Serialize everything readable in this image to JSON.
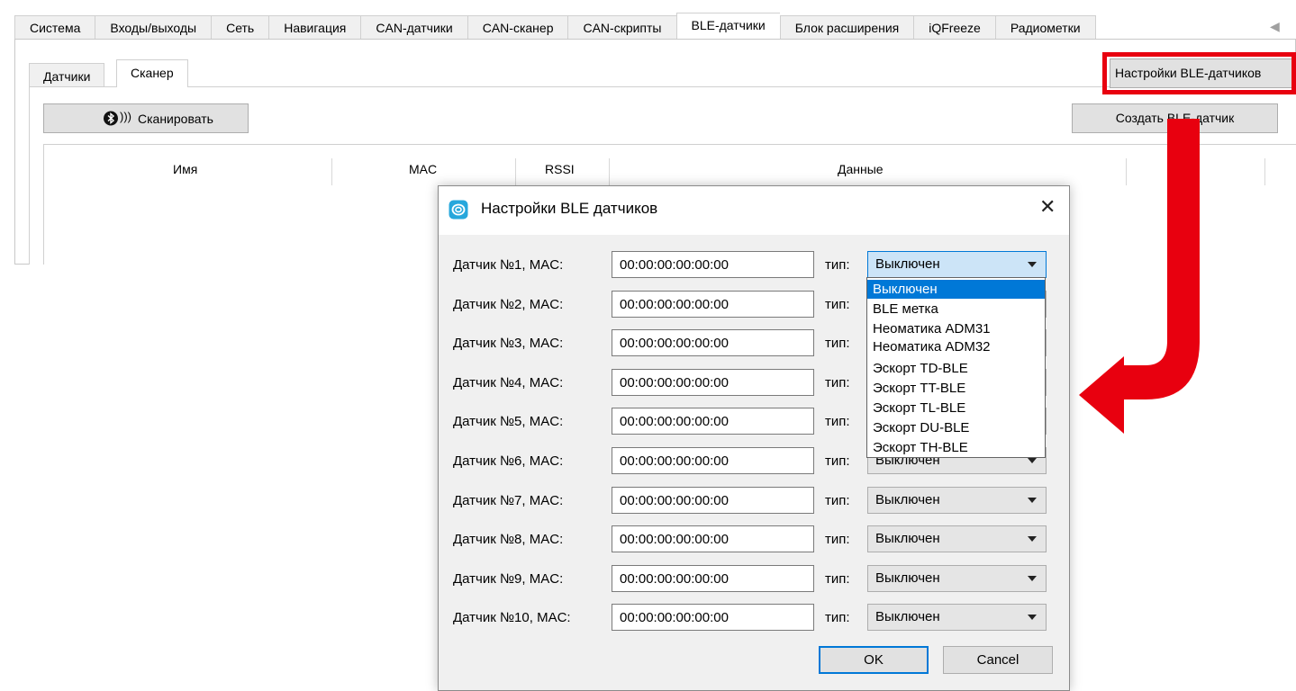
{
  "main_tabs": [
    "Система",
    "Входы/выходы",
    "Сеть",
    "Навигация",
    "CAN-датчики",
    "CAN-сканер",
    "CAN-скрипты",
    "BLE-датчики",
    "Блок расширения",
    "iQFreeze",
    "Радиометки"
  ],
  "active_main_tab": "BLE-датчики",
  "sub_tabs": {
    "sensors": "Датчики",
    "scanner": "Сканер"
  },
  "toolbar": {
    "scan_label": "Сканировать",
    "ble_settings_label": "Настройки BLE-датчиков",
    "create_sensor_label": "Создать BLE-датчик"
  },
  "table": {
    "col_name": "Имя",
    "col_mac": "MAC",
    "col_rssi": "RSSI",
    "col_data": "Данные"
  },
  "dialog": {
    "title": "Настройки BLE датчиков",
    "type_label": "тип:",
    "ok_label": "OK",
    "cancel_label": "Cancel",
    "rows": [
      {
        "label": "Датчик №1, MAC:",
        "mac": "00:00:00:00:00:00",
        "type": "Выключен"
      },
      {
        "label": "Датчик №2, MAC:",
        "mac": "00:00:00:00:00:00",
        "type": "Выключен"
      },
      {
        "label": "Датчик №3, MAC:",
        "mac": "00:00:00:00:00:00",
        "type": "Выключен"
      },
      {
        "label": "Датчик №4, MAC:",
        "mac": "00:00:00:00:00:00",
        "type": "Выключен"
      },
      {
        "label": "Датчик №5, MAC:",
        "mac": "00:00:00:00:00:00",
        "type": "Выключен"
      },
      {
        "label": "Датчик №6, MAC:",
        "mac": "00:00:00:00:00:00",
        "type": "Выключен"
      },
      {
        "label": "Датчик №7, MAC:",
        "mac": "00:00:00:00:00:00",
        "type": "Выключен"
      },
      {
        "label": "Датчик №8, MAC:",
        "mac": "00:00:00:00:00:00",
        "type": "Выключен"
      },
      {
        "label": "Датчик №9, MAC:",
        "mac": "00:00:00:00:00:00",
        "type": "Выключен"
      },
      {
        "label": "Датчик №10, MAC:",
        "mac": "00:00:00:00:00:00",
        "type": "Выключен"
      }
    ],
    "dropdown_options": [
      "Выключен",
      "BLE метка",
      "Неоматика ADM31",
      "Неоматика ADM32",
      "Эскорт TD-BLE",
      "Эскорт TT-BLE",
      "Эскорт TL-BLE",
      "Эскорт DU-BLE",
      "Эскорт TH-BLE"
    ],
    "dropdown_selected": "Выключен"
  },
  "colors": {
    "highlight": "#e8000f",
    "accent": "#0078d7",
    "dialog_icon": "#27a7dc"
  }
}
